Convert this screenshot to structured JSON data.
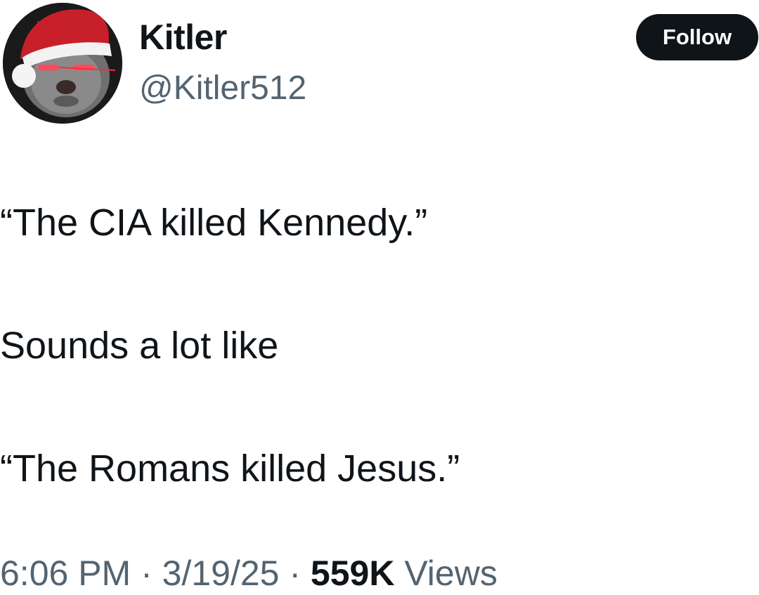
{
  "author": {
    "display_name": "Kitler",
    "handle": "@Kitler512",
    "avatar_icon": "cat-santa-hat-avatar"
  },
  "follow_label": "Follow",
  "tweet": {
    "lines": [
      "“The CIA killed Kennedy.”",
      "Sounds a lot like",
      "“The Romans killed Jesus.”"
    ]
  },
  "meta": {
    "time": "6:06 PM",
    "separator": " · ",
    "date": "3/19/25",
    "views_count": "559K",
    "views_label": "Views"
  },
  "colors": {
    "text_primary": "#0f1419",
    "text_secondary": "#536471",
    "button_bg": "#0f1419",
    "button_text": "#ffffff"
  }
}
